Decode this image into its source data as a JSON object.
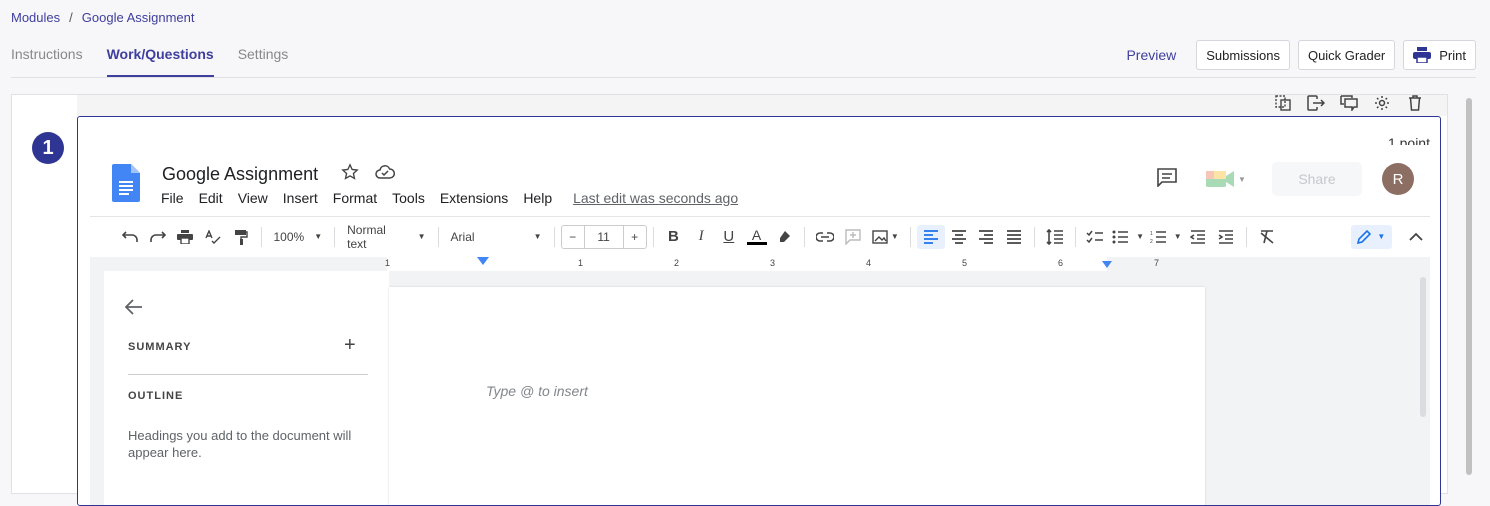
{
  "breadcrumb": {
    "root": "Modules",
    "current": "Google Assignment",
    "separator": "/"
  },
  "tabs": [
    {
      "label": "Instructions",
      "active": false
    },
    {
      "label": "Work/Questions",
      "active": true
    },
    {
      "label": "Settings",
      "active": false
    }
  ],
  "actions": {
    "preview": "Preview",
    "submissions": "Submissions",
    "quick_grader": "Quick Grader",
    "print": "Print"
  },
  "question": {
    "number": "1",
    "points": "1 point"
  },
  "question_tools": [
    "copy-icon",
    "move-out-icon",
    "comments-icon",
    "gear-icon",
    "trash-icon"
  ],
  "docs": {
    "title": "Google Assignment",
    "menu": [
      "File",
      "Edit",
      "View",
      "Insert",
      "Format",
      "Tools",
      "Extensions",
      "Help"
    ],
    "last_edit": "Last edit was seconds ago",
    "share": "Share",
    "avatar_initial": "R",
    "toolbar": {
      "zoom": "100%",
      "style": "Normal text",
      "font": "Arial",
      "font_size": "11"
    },
    "ruler_numbers": [
      "1",
      "1",
      "2",
      "3",
      "4",
      "5",
      "6",
      "7"
    ],
    "sidebar": {
      "summary": "SUMMARY",
      "outline": "OUTLINE",
      "outline_msg": "Headings you add to the document will appear here."
    },
    "placeholder": "Type @ to insert"
  },
  "colors": {
    "brand": "#2f3593",
    "docs_blue": "#4285f4"
  }
}
